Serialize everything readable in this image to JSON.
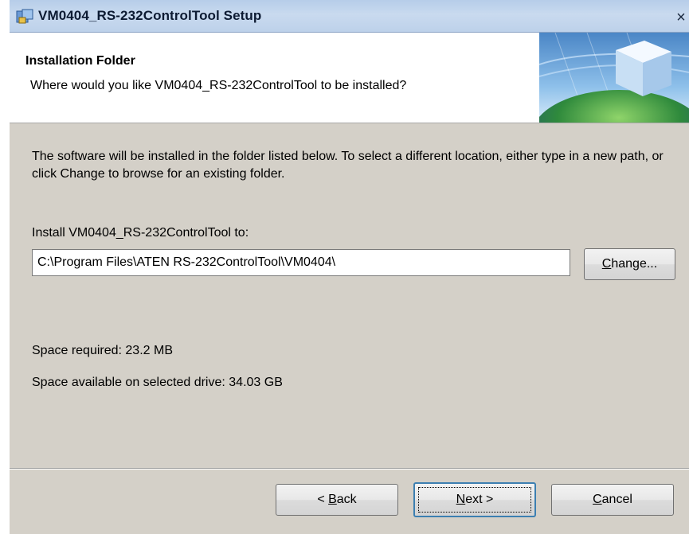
{
  "window": {
    "title": "VM0404_RS-232ControlTool Setup",
    "close_glyph": "×",
    "icon": "installer-icon"
  },
  "banner": {
    "title": "Installation Folder",
    "subtitle": "Where would you like VM0404_RS-232ControlTool to be installed?",
    "graphic": "installer-cube-globe-graphic"
  },
  "body": {
    "description": "The software will be installed in the folder listed below. To select a different location, either type in a new path, or click Change to browse for an existing folder.",
    "install_label": "Install VM0404_RS-232ControlTool to:",
    "install_path": "C:\\Program Files\\ATEN RS-232ControlTool\\VM0404\\",
    "space_required": "Space required: 23.2 MB",
    "space_available": "Space available on selected drive: 34.03 GB"
  },
  "buttons": {
    "change": {
      "pre": "",
      "accel": "C",
      "post": "hange..."
    },
    "back": {
      "pre": "< ",
      "accel": "B",
      "post": "ack"
    },
    "next": {
      "pre": "",
      "accel": "N",
      "post": "ext >"
    },
    "cancel": {
      "pre": "",
      "accel": "C",
      "post": "ancel"
    }
  },
  "colors": {
    "titlebar": "#bdd1ea",
    "dialog_face": "#d4d0c8",
    "focus_border": "#3c7fb1"
  }
}
